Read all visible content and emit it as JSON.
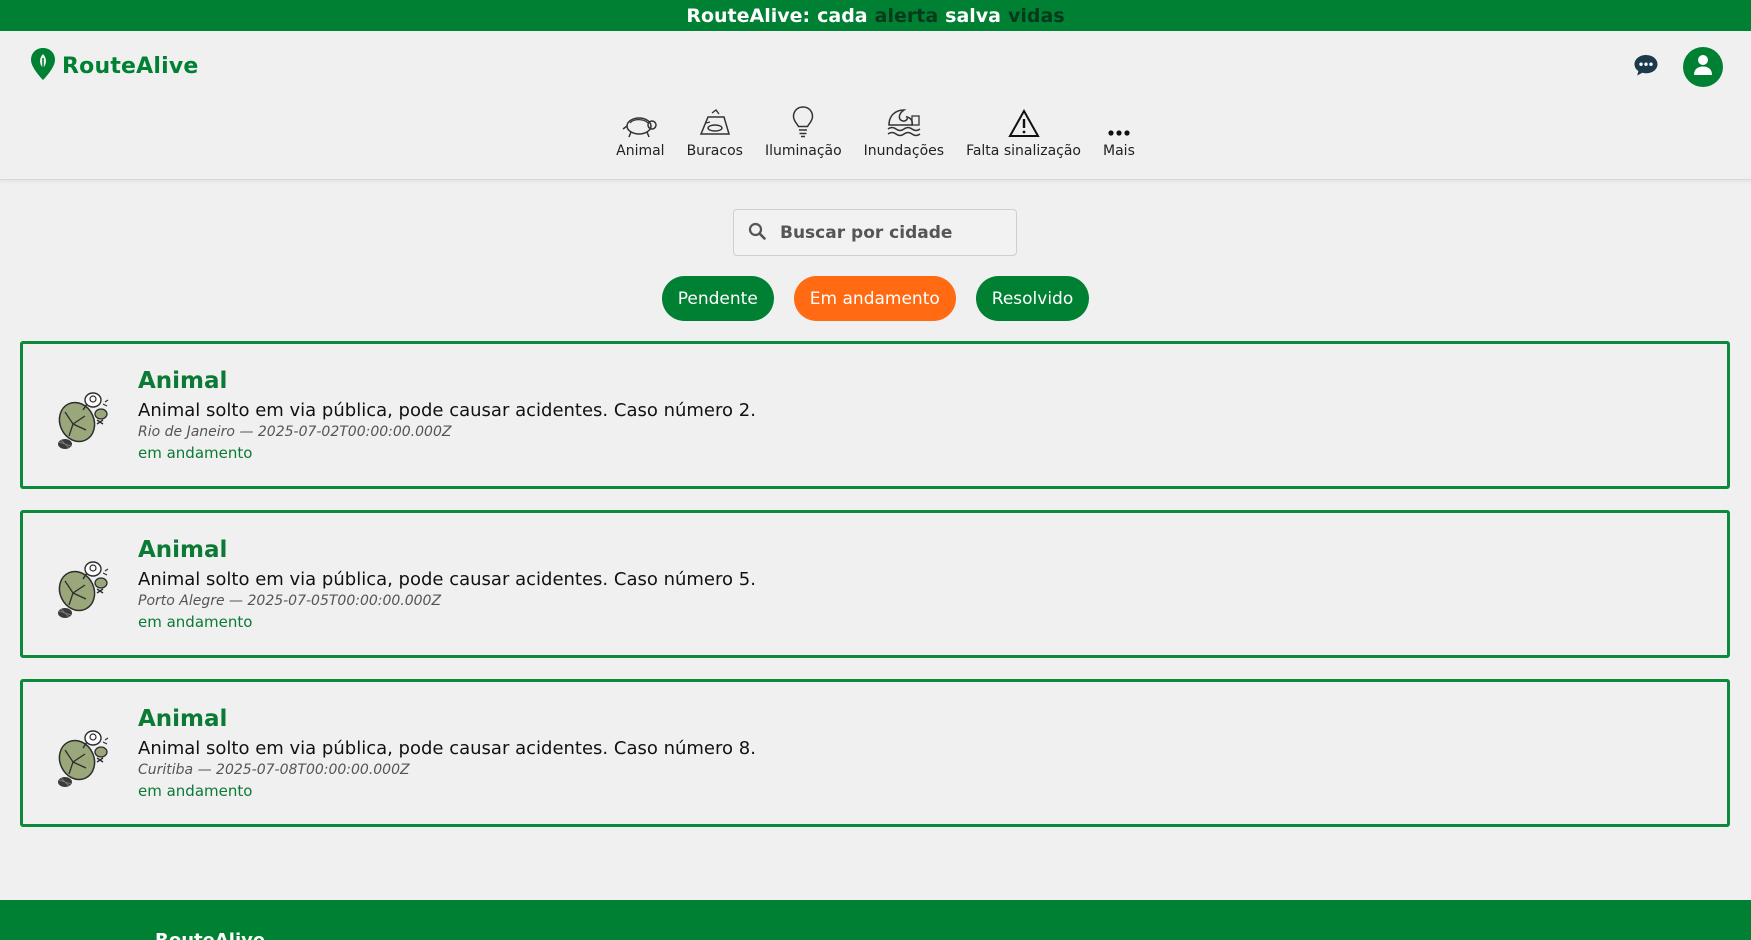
{
  "banner": {
    "words": [
      {
        "text": "RouteAlive:",
        "tone": "light"
      },
      {
        "text": "cada",
        "tone": "light"
      },
      {
        "text": "alerta",
        "tone": "dark"
      },
      {
        "text": "salva",
        "tone": "light"
      },
      {
        "text": "vidas",
        "tone": "dark"
      }
    ]
  },
  "header": {
    "logo_text": "RouteAlive",
    "logo_icon": "map-pin-leaf-icon",
    "chat_icon": "chat-bubble-icon",
    "profile_icon": "user-avatar-icon"
  },
  "categories": [
    {
      "label": "Animal",
      "icon": "animal-icon"
    },
    {
      "label": "Buracos",
      "icon": "pothole-icon"
    },
    {
      "label": "Iluminação",
      "icon": "lightbulb-icon"
    },
    {
      "label": "Inundações",
      "icon": "flood-icon"
    },
    {
      "label": "Falta sinalização",
      "icon": "warning-sign-icon"
    },
    {
      "label": "Mais",
      "icon": "more-dots-icon"
    }
  ],
  "search": {
    "placeholder": "Buscar por cidade",
    "value": ""
  },
  "filters": [
    {
      "label": "Pendente",
      "active": false
    },
    {
      "label": "Em andamento",
      "active": true
    },
    {
      "label": "Resolvido",
      "active": false
    }
  ],
  "reports": [
    {
      "title": "Animal",
      "description": "Animal solto em via pública, pode causar acidentes. Caso número 2.",
      "meta": "Rio de Janeiro — 2025-07-02T00:00:00.000Z",
      "status": "em andamento",
      "icon": "turtle-icon"
    },
    {
      "title": "Animal",
      "description": "Animal solto em via pública, pode causar acidentes. Caso número 5.",
      "meta": "Porto Alegre — 2025-07-05T00:00:00.000Z",
      "status": "em andamento",
      "icon": "turtle-icon"
    },
    {
      "title": "Animal",
      "description": "Animal solto em via pública, pode causar acidentes. Caso número 8.",
      "meta": "Curitiba — 2025-07-08T00:00:00.000Z",
      "status": "em andamento",
      "icon": "turtle-icon"
    }
  ],
  "colors": {
    "brand": "#008033",
    "accent": "#ff6a13",
    "background": "#f0f0f0"
  }
}
